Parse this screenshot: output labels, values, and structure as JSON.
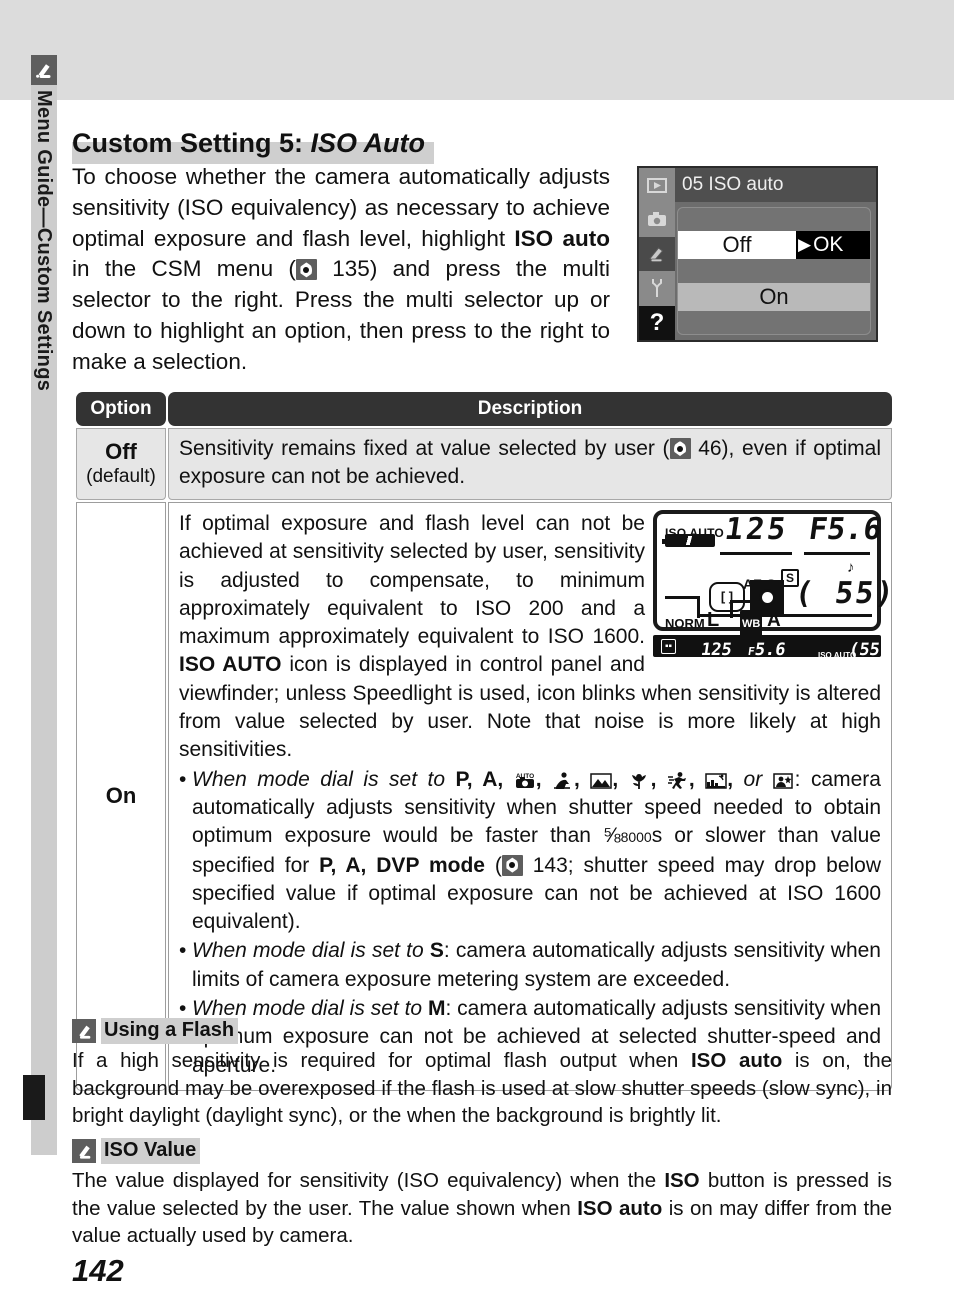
{
  "sidebar": {
    "icon": "pencil-icon",
    "label": "Menu Guide—Custom Settings"
  },
  "heading": {
    "prefix": "Custom Setting 5: ",
    "italic": "ISO Auto"
  },
  "intro": {
    "part1": "To choose whether the camera automatically adjusts sensitivity (ISO equivalency) as necessary to achieve optimal exposure and flash level, highlight ",
    "bold1": "ISO auto",
    "part2": " in the CSM menu (",
    "ref1": "135",
    "part3": ") and press the multi selector to the right.  Press the multi selector up or down to highlight an option, then press to the right to make a selection."
  },
  "menu_screenshot": {
    "title": "05 ISO auto",
    "tabs": [
      "playback-icon",
      "camera-icon",
      "pencil-icon",
      "wrench-icon",
      "help-icon"
    ],
    "selected_row": {
      "label": "Off",
      "action": "OK",
      "arrow": "▶"
    },
    "other_row": {
      "label": "On"
    }
  },
  "table": {
    "headers": {
      "option": "Option",
      "description": "Description"
    },
    "rows": [
      {
        "option": "Off",
        "option_sub": "(default)",
        "description_part1": "Sensitivity remains fixed at value selected by user (",
        "description_ref": "46",
        "description_part2": "), even if optimal exposure can not be achieved."
      },
      {
        "option": "On",
        "para_part1": "If optimal exposure and flash level can not be achieved at sensitivity selected by user, sensitivity is adjusted to compensate, to minimum approximately equivalent to ISO 200 and a maximum approximately equivalent to ISO 1600.  ",
        "para_bold": "ISO AUTO",
        "para_part2": " icon is displayed in control panel and viewfinder; unless Speedlight is used, icon blinks when sensitivity is altered from value selected by user.  Note that noise is more likely at high sensitivities.",
        "bullets": [
          {
            "marker": "•",
            "italic_lead": "When mode dial is set to ",
            "modes_text": "P, A,",
            "mode_icons": [
              "auto-camera-icon",
              "portrait-icon",
              "landscape-icon",
              "close-up-icon",
              "sports-icon",
              "night-landscape-icon",
              "night-portrait-icon"
            ],
            "or_word": "or",
            "rest_part1": ": camera automatically adjusts sensitivity when shutter speed needed to obtain optimum exposure would be faster than ",
            "fraction": "1/8000",
            "unit": "s",
            "rest_part2": " or slower than value specified for ",
            "bold_mode": "P, A, DVP mode",
            "rest_part3": " (",
            "ref": "143",
            "rest_part4": "; shutter speed may drop below specified value if optimal exposure can not be achieved at ISO 1600 equivalent)."
          },
          {
            "marker": "•",
            "italic_lead": "When mode dial is set to ",
            "bold_mode": "S",
            "rest": ": camera automatically adjusts sensitivity when limits of camera exposure metering system are exceeded."
          },
          {
            "marker": "•",
            "italic_lead": "When mode dial is set to ",
            "bold_mode": "M",
            "rest": ": camera automatically adjusts sensitivity when optimum exposure can not be achieved at selected shutter-speed and aperture."
          }
        ]
      }
    ]
  },
  "lcd_panel": {
    "iso_auto_label": "ISO AUTO",
    "shutter_speed": "125",
    "aperture": "F5.6",
    "beep": "♪",
    "af_mode": "AF-S",
    "area_mode": "S",
    "bracket": "[ ]",
    "frames_remaining": "55",
    "quality": "NORM",
    "image_size": "L",
    "wb_label": "WB",
    "wb_value": "A"
  },
  "viewfinder_strip": {
    "focus_indicator": "⬚",
    "shutter_speed": "125",
    "aperture_prefix": "F",
    "aperture": "5.6",
    "iso_auto_label": "ISO AUTO",
    "frames": "55"
  },
  "notes": [
    {
      "icon": "pencil-note-icon",
      "title": "Using a Flash",
      "part1": "If a high sensitivity is required for optimal flash output when ",
      "bold1": "ISO auto",
      "part2": " is on, the background may be overexposed if the flash is used at slow shutter speeds (slow sync), in bright daylight (daylight sync), or the when the background is brightly lit."
    },
    {
      "icon": "pencil-note-icon",
      "title": "ISO Value",
      "part1": "The value displayed for sensitivity (ISO equivalency) when the ",
      "bold1": "ISO",
      "part2": " button is pressed is the value selected by the user.  The value shown when ",
      "bold2": "ISO auto",
      "part3": " is on may differ from the value actually used by camera."
    }
  ],
  "page_number": "142",
  "colors": {
    "top_band": "#dcdcdc",
    "rail": "#cdcdcd",
    "icon_box": "#5e5e5e",
    "table_header": "#333333",
    "row_shaded": "#e6e6e6",
    "highlight": "#cfcfcf"
  }
}
